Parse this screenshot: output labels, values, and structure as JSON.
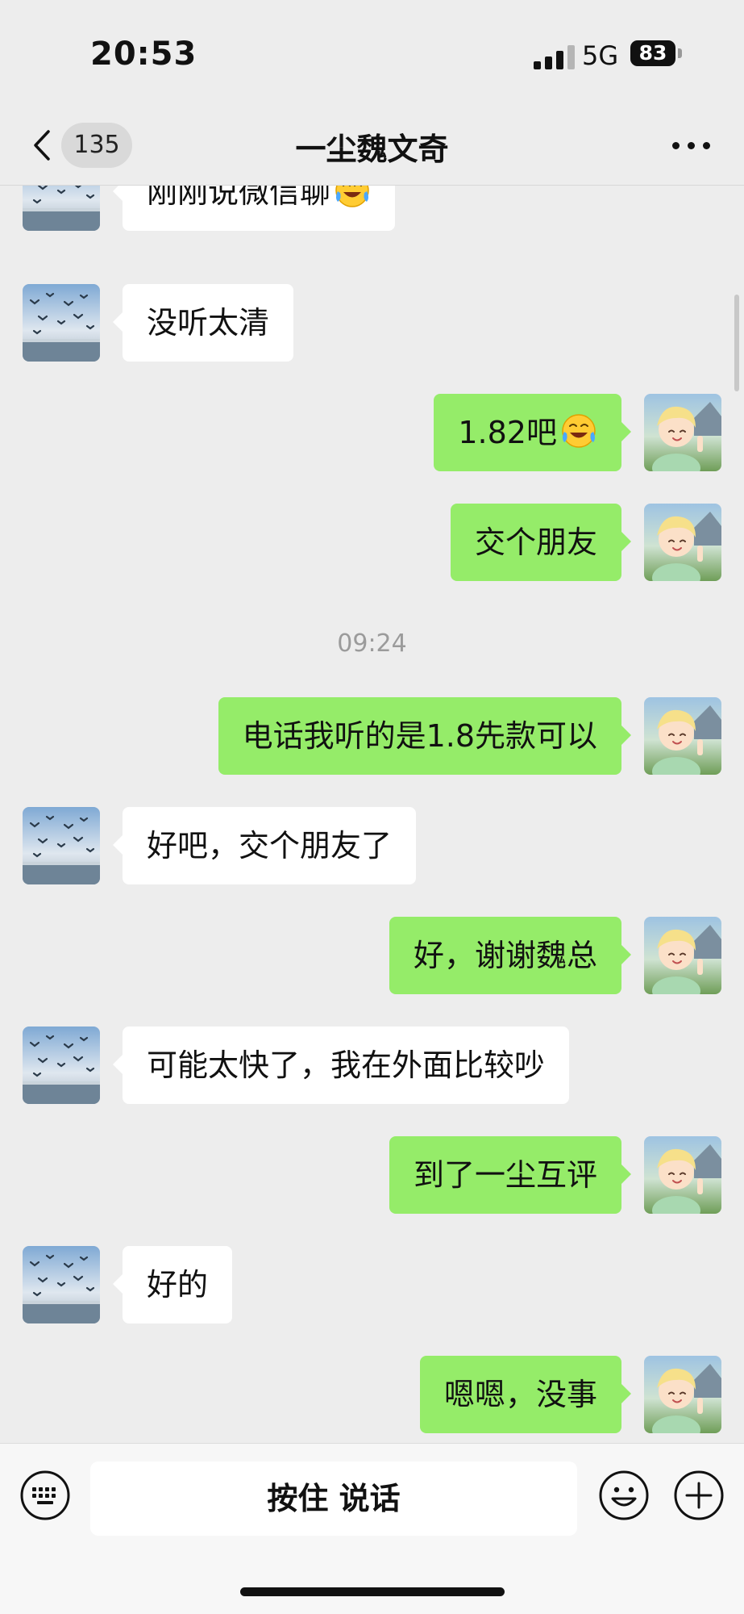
{
  "status_bar": {
    "time": "20:53",
    "network": "5G",
    "battery": "83"
  },
  "nav": {
    "unread_count": "135",
    "title": "一尘魏文奇"
  },
  "messages": [
    {
      "dir": "in",
      "text": "刚刚说微信聊",
      "emoji": "tears-of-joy-emoji",
      "avatar": "seagulls-avatar"
    },
    {
      "dir": "in",
      "text": "没听太清",
      "avatar": "seagulls-avatar"
    },
    {
      "dir": "out",
      "text": "1.82吧",
      "emoji": "tears-of-joy-emoji",
      "avatar": "smiling-child-avatar"
    },
    {
      "dir": "out",
      "text": "交个朋友",
      "avatar": "smiling-child-avatar"
    },
    {
      "timestamp": "09:24"
    },
    {
      "dir": "out",
      "text": "电话我听的是1.8先款可以",
      "avatar": "smiling-child-avatar"
    },
    {
      "dir": "in",
      "text": "好吧，交个朋友了",
      "avatar": "seagulls-avatar"
    },
    {
      "dir": "out",
      "text": "好，谢谢魏总",
      "avatar": "smiling-child-avatar"
    },
    {
      "dir": "in",
      "text": "可能太快了，我在外面比较吵",
      "avatar": "seagulls-avatar"
    },
    {
      "dir": "out",
      "text": "到了一尘互评",
      "avatar": "smiling-child-avatar"
    },
    {
      "dir": "in",
      "text": "好的",
      "avatar": "seagulls-avatar"
    },
    {
      "dir": "out",
      "text": "嗯嗯，没事",
      "avatar": "smiling-child-avatar"
    }
  ],
  "input_bar": {
    "hold_to_talk": "按住 说话"
  },
  "colors": {
    "background": "#ededed",
    "bubble_out": "#95ec69",
    "bubble_in": "#ffffff",
    "timestamp": "#9b9b9b"
  }
}
